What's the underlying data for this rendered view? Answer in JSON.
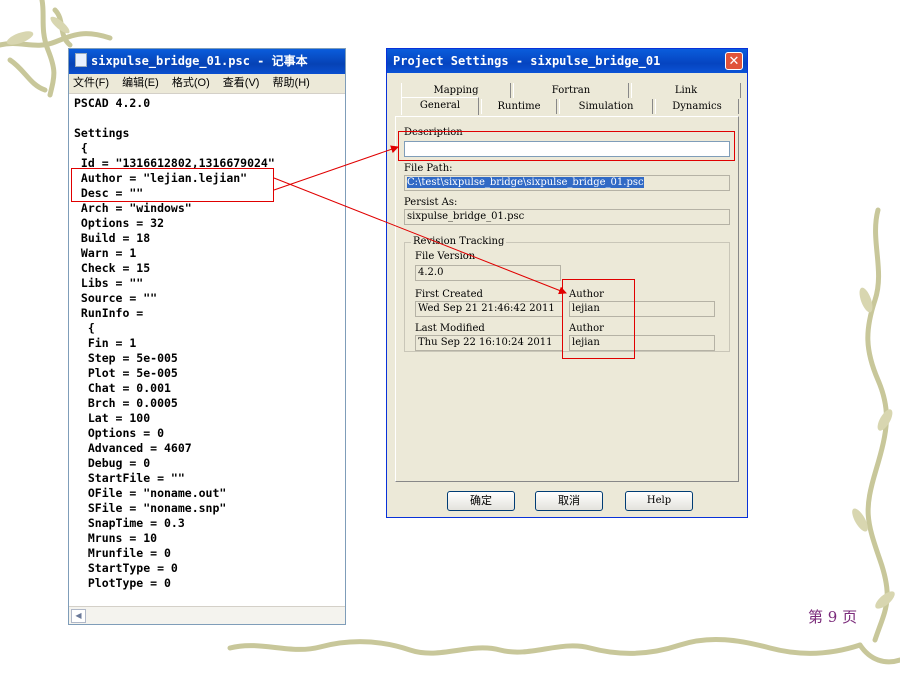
{
  "notepad": {
    "title": "sixpulse_bridge_01.psc - 记事本",
    "menu": [
      "文件(F)",
      "编辑(E)",
      "格式(O)",
      "查看(V)",
      "帮助(H)"
    ],
    "lines": [
      "PSCAD 4.2.0",
      "",
      "Settings",
      " {",
      " Id = \"1316612802,1316679024\"",
      " Author = \"lejian.lejian\"",
      " Desc = \"\"",
      " Arch = \"windows\"",
      " Options = 32",
      " Build = 18",
      " Warn = 1",
      " Check = 15",
      " Libs = \"\"",
      " Source = \"\"",
      " RunInfo =",
      "  {",
      "  Fin = 1",
      "  Step = 5e-005",
      "  Plot = 5e-005",
      "  Chat = 0.001",
      "  Brch = 0.0005",
      "  Lat = 100",
      "  Options = 0",
      "  Advanced = 4607",
      "  Debug = 0",
      "  StartFile = \"\"",
      "  OFile = \"noname.out\"",
      "  SFile = \"noname.snp\"",
      "  SnapTime = 0.3",
      "  Mruns = 10",
      "  Mrunfile = 0",
      "  StartType = 0",
      "  PlotType = 0"
    ]
  },
  "dialog": {
    "title": "Project Settings - sixpulse_bridge_01",
    "close_glyph": "✕",
    "tabs_row1": [
      "Mapping",
      "Fortran",
      "Link"
    ],
    "tabs_row2": [
      "General",
      "Runtime",
      "Simulation",
      "Dynamics"
    ],
    "description_label": "Description",
    "description_value": "",
    "file_path_label": "File Path:",
    "file_path_value": "C:\\test\\sixpulse_bridge\\sixpulse_bridge_01.psc",
    "persist_label": "Persist As:",
    "persist_value": "sixpulse_bridge_01.psc",
    "revision": {
      "title": "Revision Tracking",
      "file_version_label": "File Version",
      "file_version_value": "4.2.0",
      "first_created_label": "First Created",
      "first_created_value": "Wed Sep 21 21:46:42 2011",
      "first_author_label": "Author",
      "first_author_value": "lejian",
      "last_modified_label": "Last Modified",
      "last_modified_value": "Thu Sep 22 16:10:24 2011",
      "last_author_label": "Author",
      "last_author_value": "lejian"
    },
    "buttons": {
      "ok": "确定",
      "cancel": "取消",
      "help": "Help"
    }
  },
  "page_number": "第 9 页",
  "colors": {
    "highlight": "#e00000",
    "title_bar": "#0a5ddc",
    "page_number": "#7a2a7a"
  }
}
